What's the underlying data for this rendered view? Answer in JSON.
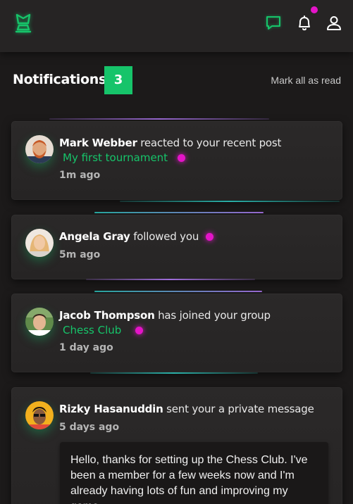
{
  "topbar": {
    "logo_icon": "chess-king-icon",
    "icons": [
      "chat-icon",
      "bell-icon",
      "user-icon"
    ],
    "accent": "#16c46a",
    "badge_color": "#e414c8"
  },
  "header": {
    "title": "Notifications",
    "count": "3",
    "mark_all": "Mark all as read"
  },
  "notifications": [
    {
      "name": "Mark Webber",
      "action": " reacted to your recent post",
      "link": "My first tournament",
      "time": "1m ago",
      "unread": true
    },
    {
      "name": "Angela Gray",
      "action": " followed you",
      "link": "",
      "time": "5m ago",
      "unread": true
    },
    {
      "name": "Jacob Thompson",
      "action": " has joined your group",
      "link": "Chess Club",
      "time": "1 day ago",
      "unread": true
    },
    {
      "name": "Rizky Hasanuddin",
      "action": " sent your a private message",
      "link": "",
      "time": "5 days ago",
      "unread": false,
      "message": "Hello, thanks for setting up the Chess Club. I've been a member for a few weeks now and I'm already having lots of fun and improving my game."
    }
  ]
}
